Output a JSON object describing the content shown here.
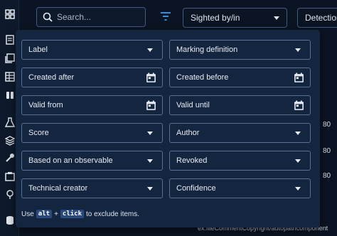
{
  "sidebar": {
    "icons": [
      "dashboard-icon",
      "analyses-icon",
      "cases-icon",
      "events-icon",
      "observations-icon",
      "threats-icon",
      "arsenal-icon",
      "techniques-icon",
      "entities-icon",
      "locations-icon",
      "data-icon"
    ]
  },
  "topbar": {
    "search_placeholder": "Search...",
    "sighted_select": "Sighted by/in",
    "detection_select": "Detection"
  },
  "background": {
    "col_values": [
      "80",
      "80",
      "80"
    ],
    "row_text": "ex:fileCommentCopyright/autopathcomponent"
  },
  "filters": {
    "label": "Label",
    "marking_definition": "Marking definition",
    "created_after": "Created after",
    "created_before": "Created before",
    "valid_from": "Valid from",
    "valid_until": "Valid until",
    "score": "Score",
    "author": "Author",
    "based_on_observable": "Based on an observable",
    "revoked": "Revoked",
    "technical_creator": "Technical creator",
    "confidence": "Confidence"
  },
  "hint": {
    "prefix": "Use",
    "key1": "alt",
    "plus": "+",
    "key2": "click",
    "suffix": "to exclude items."
  },
  "colors": {
    "background": "#0b1423",
    "panel": "#142540",
    "accent": "#2f8fe0",
    "field_border": "#5a6f92"
  }
}
